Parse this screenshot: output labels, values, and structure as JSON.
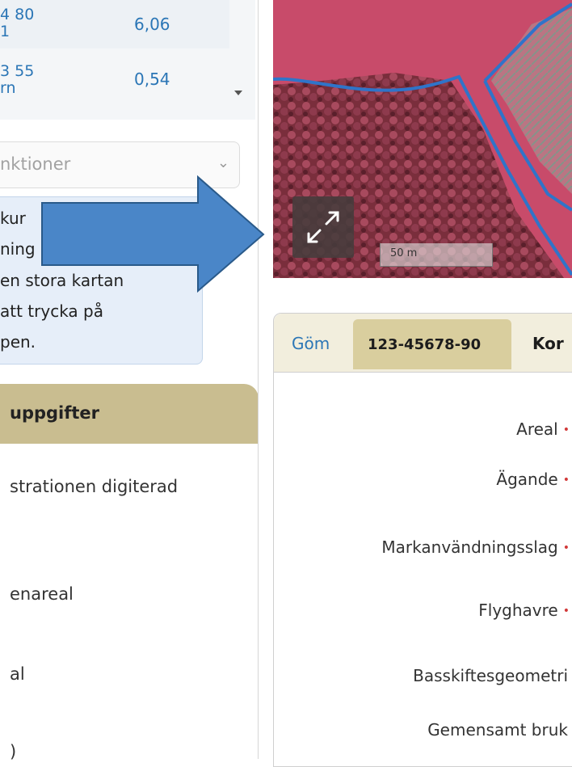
{
  "table": {
    "rows": [
      {
        "line1": "4 80",
        "line2": "1",
        "value": "6,06"
      },
      {
        "line1": "3 55",
        "line2": "rn",
        "value": "0,54"
      }
    ]
  },
  "select": {
    "value": "nktioner"
  },
  "info": {
    "lines": [
      "kur",
      "ning",
      "en stora kartan",
      "att trycka på",
      "pen."
    ]
  },
  "section": {
    "title": "uppgifter",
    "items": [
      "strationen digiterad",
      "enareal",
      "al",
      ")"
    ]
  },
  "map": {
    "scale_label": "50 m"
  },
  "form": {
    "hide_tab": "Göm",
    "active_tab": "123-45678-90",
    "next_tab": "Kor",
    "fields": [
      {
        "label": "Areal",
        "required": "•"
      },
      {
        "label": "Ägande",
        "required": "•"
      },
      {
        "label": "Markanvändningsslag",
        "required": "•"
      },
      {
        "label": "Flyghavre",
        "required": "•"
      },
      {
        "label": "Basskiftesgeometri",
        "required": ""
      },
      {
        "label": "Gemensamt bruk",
        "required": ""
      }
    ]
  },
  "colors": {
    "accent_blue": "#2b76b6",
    "section_header": "#c9bd90",
    "arrow_fill": "#4a86c8",
    "required_mark": "#d23a3a"
  }
}
